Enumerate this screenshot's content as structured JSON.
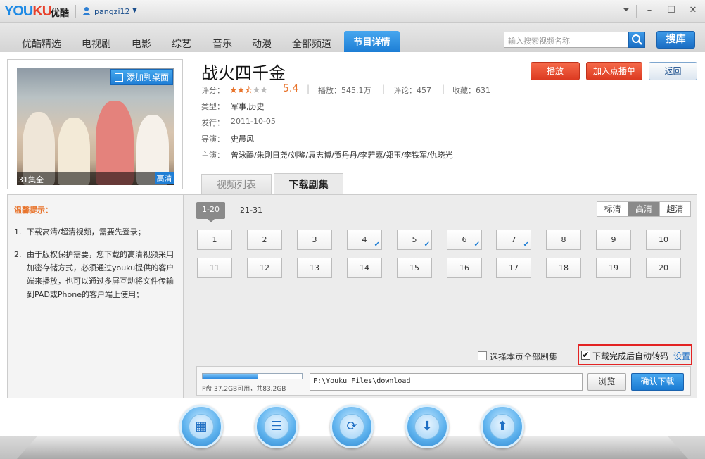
{
  "app": {
    "logo_brand": "YOUKU",
    "logo_cn": "优酷",
    "username": "pangzi12"
  },
  "nav": {
    "tabs": [
      "优酷精选",
      "电视剧",
      "电影",
      "综艺",
      "音乐",
      "动漫",
      "全部频道"
    ],
    "active_tab": "节目详情",
    "search_placeholder": "输入搜索视频名称",
    "search_button": "搜库"
  },
  "show": {
    "title": "战火四千金",
    "add_desktop": "添加到桌面",
    "episode_count": "31集全",
    "hd_badge": "高清",
    "rating_label": "评分：",
    "rating_stars": 2.5,
    "score": "5.4",
    "plays_label": "播放：545.1万",
    "comments_label": "评论：457",
    "favorites_label": "收藏：631",
    "genre_label": "类型：",
    "genre": "军事,历史",
    "release_label": "发行：",
    "release": "2011-10-05",
    "director_label": "导演：",
    "director": "史晨风",
    "cast_label": "主演：",
    "cast": "曾泳醍/朱刚日尧/刘鉴/袁志博/贺丹丹/李若嘉/郑玉/李铁军/仇晓光"
  },
  "actions": {
    "play": "播放",
    "add_playlist": "加入点播单",
    "back": "返回"
  },
  "tabs": {
    "videos": "视频列表",
    "download": "下载剧集"
  },
  "tips": {
    "title": "温馨提示：",
    "items": [
      {
        "num": "1.",
        "text": "下载高清/超清视频，需要先登录；"
      },
      {
        "num": "2.",
        "text": "由于版权保护需要，您下载的高清视频采用加密存储方式，必须通过youku提供的客户端来播放，也可以通过多屏互动将文件传输到PAD或Phone的客户端上使用；"
      }
    ]
  },
  "download": {
    "ranges": [
      "1-20",
      "21-31"
    ],
    "quality": [
      "标清",
      "高清",
      "超清"
    ],
    "quality_selected": "高清",
    "episodes": [
      {
        "n": "1",
        "done": false
      },
      {
        "n": "2",
        "done": false
      },
      {
        "n": "3",
        "done": false
      },
      {
        "n": "4",
        "done": true
      },
      {
        "n": "5",
        "done": true
      },
      {
        "n": "6",
        "done": true
      },
      {
        "n": "7",
        "done": true
      },
      {
        "n": "8",
        "done": false
      },
      {
        "n": "9",
        "done": false
      },
      {
        "n": "10",
        "done": false
      },
      {
        "n": "11",
        "done": false
      },
      {
        "n": "12",
        "done": false
      },
      {
        "n": "13",
        "done": false
      },
      {
        "n": "14",
        "done": false
      },
      {
        "n": "15",
        "done": false
      },
      {
        "n": "16",
        "done": false
      },
      {
        "n": "17",
        "done": false
      },
      {
        "n": "18",
        "done": false
      },
      {
        "n": "19",
        "done": false
      },
      {
        "n": "20",
        "done": false
      }
    ],
    "select_all_label": "选择本页全部剧集",
    "transcode_label": "下载完成后自动转码",
    "transcode_checked": true,
    "settings_link": "设置",
    "disk_usage_fraction": 0.55,
    "disk_info": "F盘  37.2GB可用，共83.2GB",
    "path": "F:\\Youku Files\\download",
    "browse": "浏览",
    "confirm": "确认下载"
  },
  "colors": {
    "brand_blue": "#1f7ed5",
    "action_red": "#dc3a21",
    "highlight_frame": "#e32323",
    "score_orange": "#e8742c"
  },
  "dock": {
    "icons": [
      "film-icon",
      "playlist-icon",
      "refresh-icon",
      "download-icon",
      "upload-icon"
    ]
  }
}
